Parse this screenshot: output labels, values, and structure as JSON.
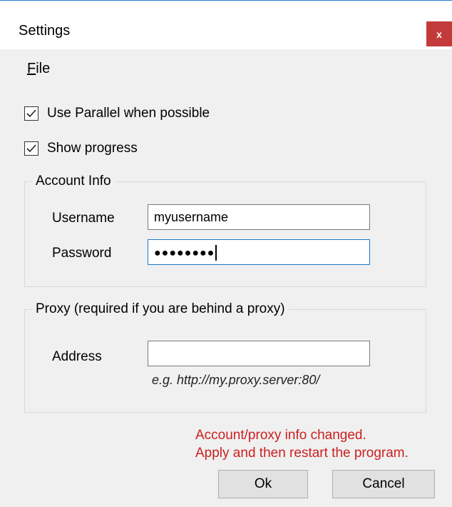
{
  "window": {
    "title": "Settings",
    "close_label": "x"
  },
  "menu": {
    "file_first": "F",
    "file_rest": "ile"
  },
  "options": {
    "use_parallel": {
      "label": "Use Parallel when possible",
      "checked": true
    },
    "show_progress": {
      "label": "Show progress",
      "checked": true
    }
  },
  "account": {
    "group_title": "Account Info",
    "username_label": "Username",
    "username_value": "myusername",
    "password_label": "Password",
    "password_masked": "●●●●●●●●"
  },
  "proxy": {
    "group_title": "Proxy (required if you are behind a proxy)",
    "address_label": "Address",
    "address_value": "",
    "address_hint": "e.g. http://my.proxy.server:80/"
  },
  "status": {
    "line1": "Account/proxy info changed.",
    "line2": "Apply and then restart the program."
  },
  "buttons": {
    "ok": "Ok",
    "cancel": "Cancel"
  },
  "colors": {
    "close_button": "#c33a3a",
    "focus_border": "#1979ca",
    "warning_text": "#cc1f1f",
    "client_background": "#f0f0f0"
  },
  "icons": {
    "check": "check-icon"
  }
}
